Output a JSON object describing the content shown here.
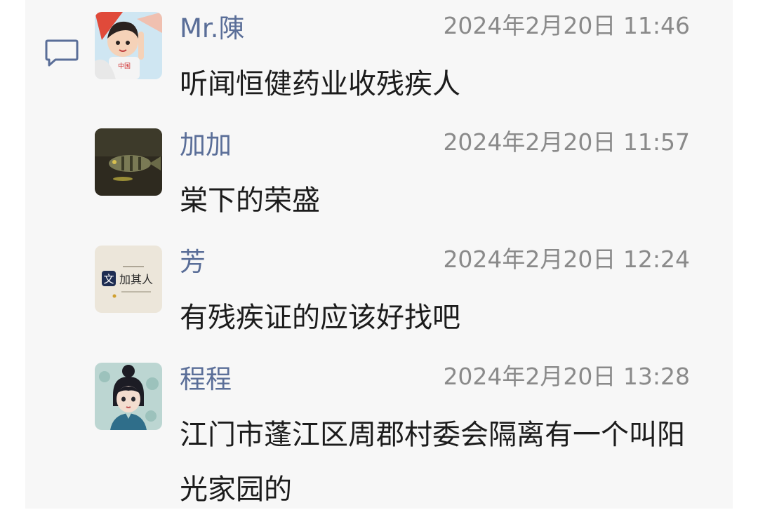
{
  "comments": [
    {
      "name": "Mr.陳",
      "time": "2024年2月20日 11:46",
      "text": "听闻恒健药业收残疾人",
      "avatar_icon": "cartoon-boy-avatar"
    },
    {
      "name": "加加",
      "time": "2024年2月20日 11:57",
      "text": "棠下的荣盛",
      "avatar_icon": "fish-avatar"
    },
    {
      "name": "芳",
      "time": "2024年2月20日 12:24",
      "text": "有残疾证的应该好找吧",
      "avatar_icon": "text-logo-avatar",
      "avatar_text": "加其人",
      "avatar_badge": "文"
    },
    {
      "name": "程程",
      "time": "2024年2月20日 13:28",
      "text": "江门市蓬江区周郡村委会隔离有一个叫阳光家园的",
      "avatar_icon": "illustrated-girl-avatar"
    }
  ],
  "colors": {
    "panel_bg": "#f7f7f7",
    "name": "#5a6e98",
    "time": "#8a8a8a",
    "text": "#1c1c1c",
    "icon": "#5a6e98"
  }
}
